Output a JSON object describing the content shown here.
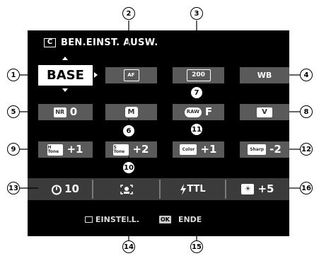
{
  "title": {
    "icon_text": "C",
    "label": "BEN.EINST. AUSW."
  },
  "cells": {
    "base": "BASE",
    "focus_icon": "AF",
    "iso_icon": "200",
    "wb_icon": "WB",
    "nr_icon": "NR",
    "nr_value": "0",
    "mode_icon": "M",
    "raw_icon": "RAW",
    "raw_value": "F",
    "film_icon": "V",
    "h_tone_icon": "H Tone",
    "h_tone_value": "+1",
    "s_tone_icon": "S Tone",
    "s_tone_value": "+2",
    "color_icon": "Color",
    "color_value": "+1",
    "sharp_icon": "Sharp",
    "sharp_value": "-2"
  },
  "bottom": {
    "self_timer_value": "10",
    "flash_value": "TTL",
    "flash_comp_value": "+5"
  },
  "footer": {
    "settings_label": "EINSTELL.",
    "ok_badge": "OK",
    "end_label": "ENDE"
  },
  "callouts": [
    "1",
    "2",
    "3",
    "4",
    "5",
    "6",
    "7",
    "8",
    "9",
    "10",
    "11",
    "12",
    "13",
    "14",
    "15",
    "16"
  ]
}
